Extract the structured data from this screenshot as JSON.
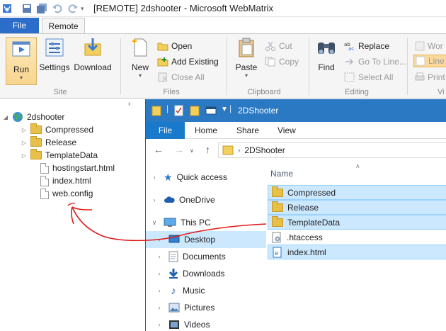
{
  "window": {
    "title": "[REMOTE] 2dshooter - Microsoft WebMatrix"
  },
  "ribbon": {
    "tabs": [
      "File",
      "Remote"
    ],
    "site": {
      "run": "Run",
      "settings": "Settings",
      "download": "Download",
      "label": "Site"
    },
    "files": {
      "new": "New",
      "open": "Open",
      "add_existing": "Add Existing",
      "close_all": "Close All",
      "label": "Files"
    },
    "clipboard": {
      "paste": "Paste",
      "cut": "Cut",
      "copy": "Copy",
      "label": "Clipboard"
    },
    "editing": {
      "find": "Find",
      "replace": "Replace",
      "goto_line": "Go To Line...",
      "select_all": "Select All",
      "label": "Editing"
    },
    "view": {
      "word": "Wor",
      "line": "Line",
      "print": "Print",
      "label": "Vi"
    }
  },
  "tree": {
    "root": "2dshooter",
    "items": [
      {
        "label": "Compressed",
        "type": "folder"
      },
      {
        "label": "Release",
        "type": "folder"
      },
      {
        "label": "TemplateData",
        "type": "folder"
      },
      {
        "label": "hostingstart.html",
        "type": "file"
      },
      {
        "label": "index.html",
        "type": "file"
      },
      {
        "label": "web.config",
        "type": "file"
      }
    ]
  },
  "explorer": {
    "title": "2DShooter",
    "tabs": [
      "File",
      "Home",
      "Share",
      "View"
    ],
    "address": "2DShooter",
    "nav": [
      "Quick access",
      "OneDrive",
      "This PC",
      "Desktop",
      "Documents",
      "Downloads",
      "Music",
      "Pictures",
      "Videos"
    ],
    "column_name": "Name",
    "items": [
      {
        "label": "Compressed",
        "type": "folder"
      },
      {
        "label": "Release",
        "type": "folder"
      },
      {
        "label": "TemplateData",
        "type": "folder"
      },
      {
        "label": ".htaccess",
        "type": "config"
      },
      {
        "label": "index.html",
        "type": "html"
      }
    ]
  },
  "colors": {
    "accent": "#2c6dc9",
    "explorer_title": "#2b79c3",
    "annotation": "#e01b1b",
    "selection": "#cce8ff"
  }
}
